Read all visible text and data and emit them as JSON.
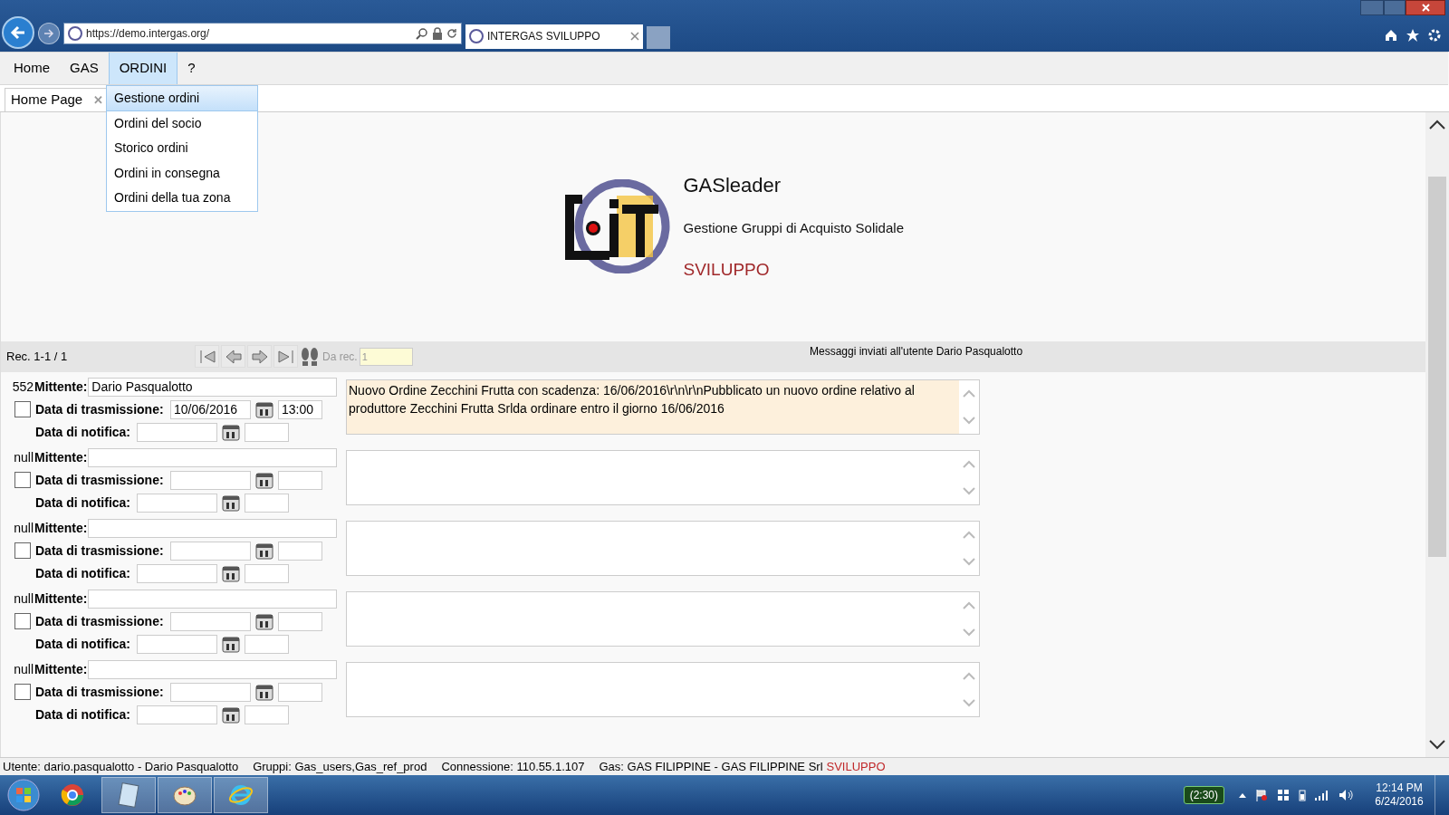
{
  "browser": {
    "url": "https://demo.intergas.org/",
    "tab_title": "INTERGAS SVILUPPO"
  },
  "menu": {
    "items": [
      {
        "label": "Home",
        "selected": false
      },
      {
        "label": "GAS",
        "selected": false
      },
      {
        "label": "ORDINI",
        "selected": true
      },
      {
        "label": "?",
        "selected": false
      }
    ],
    "dropdown": [
      {
        "label": "Gestione ordini",
        "selected": true
      },
      {
        "label": "Ordini del socio",
        "selected": false
      },
      {
        "label": "Storico ordini",
        "selected": false
      },
      {
        "label": "Ordini in consegna",
        "selected": false
      },
      {
        "label": "Ordini della tua zona",
        "selected": false
      }
    ]
  },
  "tabs": [
    {
      "label": "Home Page",
      "close": "✕"
    }
  ],
  "header": {
    "title": "GASleader",
    "subtitle": "Gestione Gruppi di Acquisto Solidale",
    "environment": "SVILUPPO"
  },
  "navigator": {
    "record_info": "Rec. 1-1 / 1",
    "from_label": "Da rec.",
    "from_value": "1",
    "caption": "Messaggi inviati all'utente Dario Pasqualotto"
  },
  "records": [
    {
      "id": "552",
      "mittente_label": "Mittente:",
      "mittente": "Dario Pasqualotto",
      "checked": false,
      "trasmissione_label": "Data di trasmissione:",
      "data_trasmissione": "10/06/2016",
      "ora_trasmissione": "13:00",
      "notifica_label": "Data di notifica:",
      "message": "Nuovo Ordine Zecchini Frutta con scadenza: 16/06/2016\\r\\n\\r\\nPubblicato un nuovo ordine relativo al produttore Zecchini Frutta Srlda ordinare entro il giorno 16/06/2016",
      "highlighted": true
    },
    {
      "id": "null",
      "mittente_label": "Mittente:",
      "checked": false,
      "trasmissione_label": "Data di trasmissione:",
      "notifica_label": "Data di notifica:",
      "highlighted": false
    },
    {
      "id": "null",
      "mittente_label": "Mittente:",
      "checked": false,
      "trasmissione_label": "Data di trasmissione:",
      "notifica_label": "Data di notifica:",
      "highlighted": false
    },
    {
      "id": "null",
      "mittente_label": "Mittente:",
      "checked": false,
      "trasmissione_label": "Data di trasmissione:",
      "notifica_label": "Data di notifica:",
      "highlighted": false
    },
    {
      "id": "null",
      "mittente_label": "Mittente:",
      "checked": false,
      "trasmissione_label": "Data di trasmissione:",
      "notifica_label": "Data di notifica:",
      "highlighted": false
    }
  ],
  "status_bar": {
    "utente": "Utente: dario.pasqualotto - Dario Pasqualotto",
    "gruppi": "Gruppi: Gas_users,Gas_ref_prod",
    "connessione": "Connessione: 110.55.1.107",
    "gas": "Gas: GAS FILIPPINE - GAS FILIPPINE Srl",
    "gas_env": "SVILUPPO"
  },
  "taskbar": {
    "battery": "(2:30)",
    "time": "12:14 PM",
    "date": "6/24/2016"
  }
}
